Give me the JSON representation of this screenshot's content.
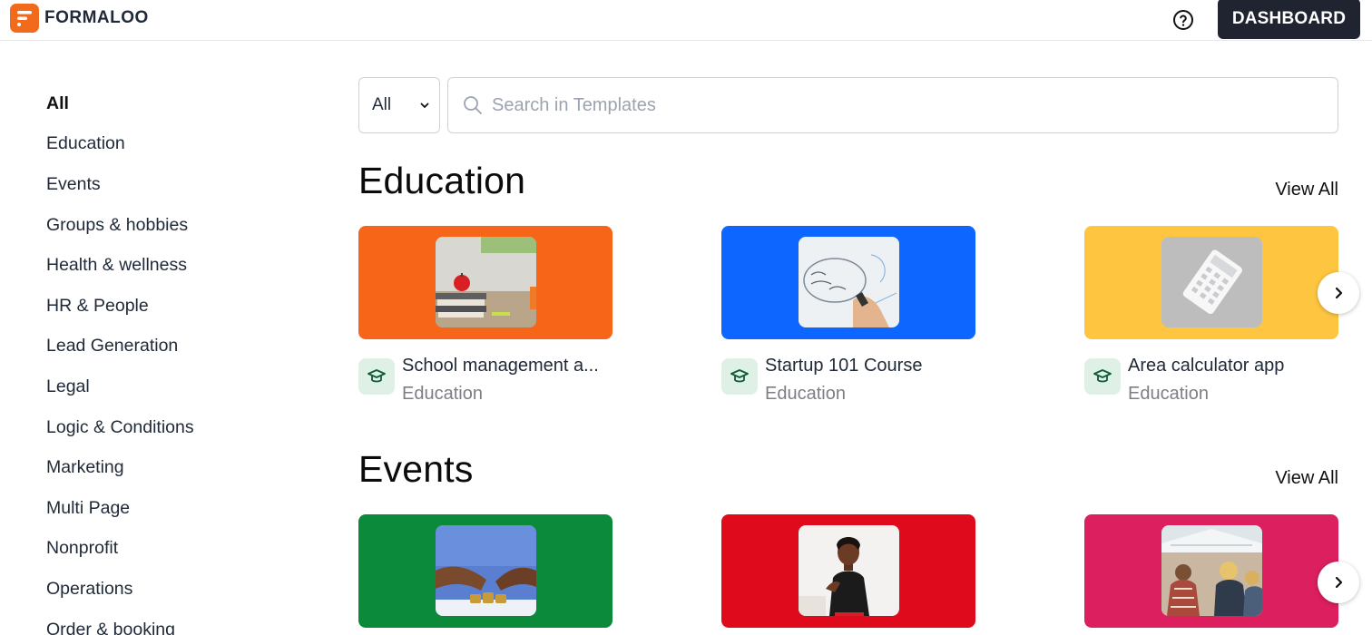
{
  "header": {
    "logo_text": "FORMALOO",
    "help_icon": "help-circle-icon",
    "dashboard_label": "DASHBOARD"
  },
  "sidebar": {
    "items": [
      {
        "label": "All",
        "active": true
      },
      {
        "label": "Education"
      },
      {
        "label": "Events"
      },
      {
        "label": "Groups & hobbies"
      },
      {
        "label": "Health & wellness"
      },
      {
        "label": "HR & People"
      },
      {
        "label": "Lead Generation"
      },
      {
        "label": "Legal"
      },
      {
        "label": "Logic & Conditions"
      },
      {
        "label": "Marketing"
      },
      {
        "label": "Multi Page"
      },
      {
        "label": "Nonprofit"
      },
      {
        "label": "Operations"
      },
      {
        "label": "Order & booking"
      }
    ]
  },
  "filter": {
    "selected": "All"
  },
  "search": {
    "placeholder": "Search in Templates",
    "value": ""
  },
  "sections": [
    {
      "title": "Education",
      "view_all": "View All",
      "cards": [
        {
          "title": "School management a...",
          "category": "Education",
          "color": "#f76519"
        },
        {
          "title": "Startup 101 Course",
          "category": "Education",
          "color": "#0c66ff"
        },
        {
          "title": "Area calculator app",
          "category": "Education",
          "color": "#fec541"
        }
      ]
    },
    {
      "title": "Events",
      "view_all": "View All",
      "cards": [
        {
          "color": "#0a8a3a"
        },
        {
          "color": "#df0b1d"
        },
        {
          "color": "#db1f5f"
        }
      ]
    }
  ]
}
